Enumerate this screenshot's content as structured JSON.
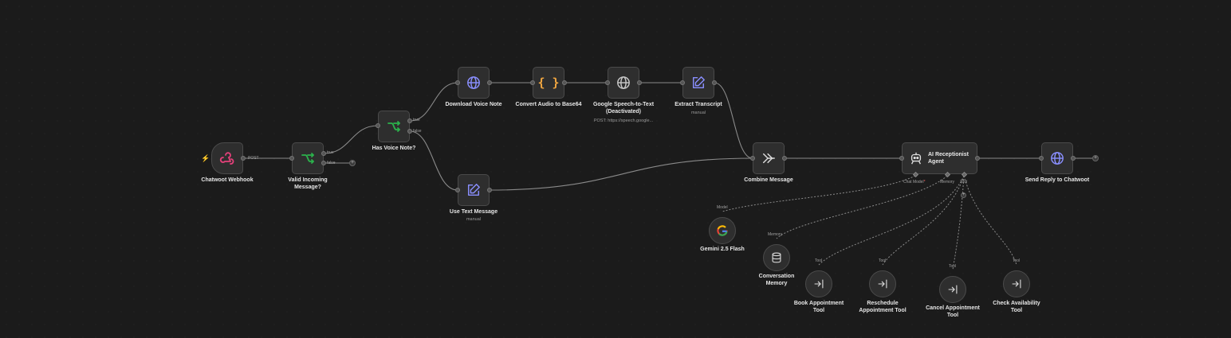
{
  "nodes": {
    "chatwoot_webhook": {
      "label": "Chatwoot Webhook",
      "icon": "webhook-icon"
    },
    "valid_incoming": {
      "label": "Valid Incoming\nMessage?",
      "icon": "if-branch-icon"
    },
    "has_voice_note": {
      "label": "Has Voice Note?",
      "icon": "if-branch-icon"
    },
    "download_voice": {
      "label": "Download Voice Note",
      "icon": "globe-icon"
    },
    "convert_audio": {
      "label": "Convert Audio to Base64",
      "icon": "code-braces-icon"
    },
    "google_stt": {
      "label": "Google Speech-to-Text\n(Deactivated)",
      "sublabel": "POST: https://speech.google...",
      "icon": "globe-icon"
    },
    "extract_transcript": {
      "label": "Extract Transcript",
      "sublabel": "manual",
      "icon": "edit-icon"
    },
    "use_text": {
      "label": "Use Text Message",
      "sublabel": "manual",
      "icon": "edit-icon"
    },
    "combine_message": {
      "label": "Combine Message",
      "icon": "merge-icon"
    },
    "ai_agent": {
      "label": "AI Receptionist\nAgent",
      "icon": "robot-icon"
    },
    "send_reply": {
      "label": "Send Reply to Chatwoot",
      "icon": "globe-icon"
    },
    "gemini": {
      "label": "Gemini 2.5 Flash",
      "icon": "google-icon"
    },
    "conversation_memory": {
      "label": "Conversation\nMemory",
      "icon": "database-icon"
    },
    "book_tool": {
      "label": "Book Appointment\nTool",
      "icon": "tool-arrow-icon"
    },
    "reschedule_tool": {
      "label": "Reschedule\nAppointment Tool",
      "icon": "tool-arrow-icon"
    },
    "cancel_tool": {
      "label": "Cancel Appointment\nTool",
      "icon": "tool-arrow-icon"
    },
    "check_tool": {
      "label": "Check Availability\nTool",
      "icon": "tool-arrow-icon"
    }
  },
  "ports": {
    "post": "POST",
    "true": "true",
    "false": "false",
    "chat_model": "Chat Model",
    "required_mark": "*",
    "memory": "Memory",
    "tool": "Tool",
    "model": "Model"
  },
  "colors": {
    "background": "#1b1b1b",
    "node_fill": "#2e2e2e",
    "node_border": "#4a4a4a",
    "edge": "#8a8a8a",
    "webhook": "#e4407a",
    "if_green": "#2bb24c",
    "http_purple": "#8a8fff",
    "code_orange": "#f0a640",
    "trigger_bolt": "#ff7a1a",
    "required_red": "#ff5a5a"
  }
}
